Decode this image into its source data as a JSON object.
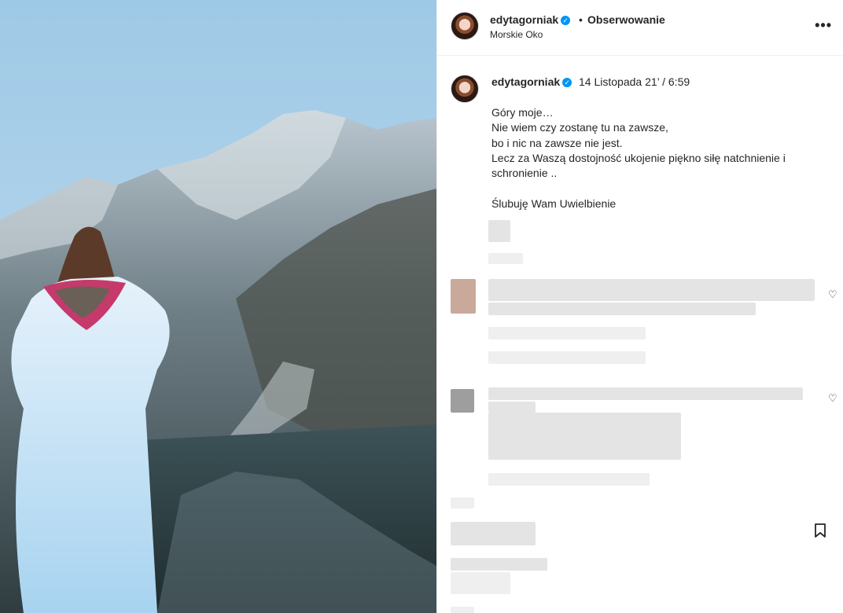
{
  "header": {
    "username": "edytagorniak",
    "verified_badge": "verified-badge",
    "separator": "•",
    "follow_label": "Obserwowanie",
    "location": "Morskie Oko",
    "more_label": "•••"
  },
  "caption": {
    "username": "edytagorniak",
    "date": "14 Listopada 21’ / 6:59",
    "text": "Góry moje…\nNie wiem czy zostanę tu na zawsze,\nbo i nic na zawsze nie jest.\nLecz za Waszą dostojność ukojenie piękno siłę natchnienie i schronienie ..\n\nŚlubuję Wam Uwielbienie"
  },
  "icons": {
    "heart": "♡",
    "check": "✓"
  },
  "colors": {
    "accent": "#0095f6",
    "text": "#262626",
    "divider": "#efefef"
  }
}
